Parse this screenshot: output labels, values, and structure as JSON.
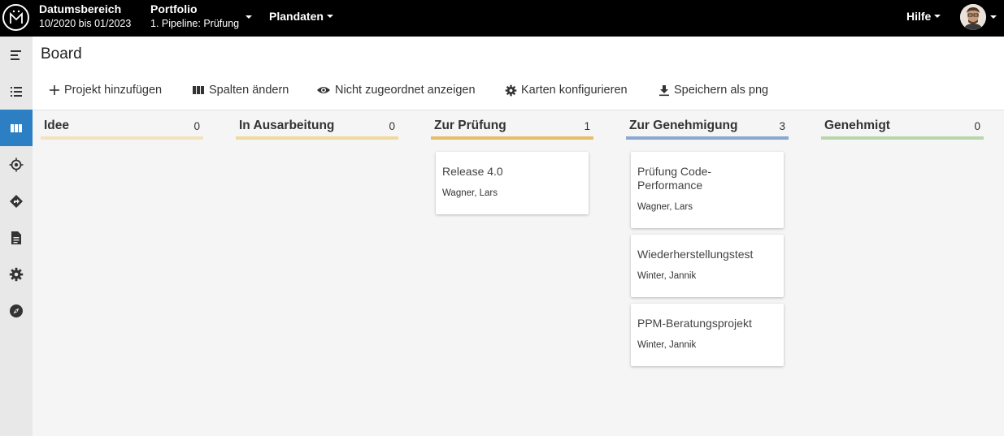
{
  "topbar": {
    "date_range": {
      "title": "Datumsbereich",
      "value": "10/2020 bis 01/2023"
    },
    "portfolio": {
      "title": "Portfolio",
      "value": "1. Pipeline: Prüfung"
    },
    "plandaten_label": "Plandaten",
    "help_label": "Hilfe"
  },
  "sidebar": {
    "items": [
      {
        "icon": "collapse-menu-icon"
      },
      {
        "icon": "list-icon"
      },
      {
        "icon": "board-icon",
        "active": true
      },
      {
        "icon": "target-icon"
      },
      {
        "icon": "directions-icon"
      },
      {
        "icon": "document-icon"
      },
      {
        "icon": "settings-icon"
      },
      {
        "icon": "compass-icon"
      }
    ]
  },
  "page": {
    "title": "Board"
  },
  "toolbar": {
    "add_project": "Projekt hinzufügen",
    "change_columns": "Spalten ändern",
    "show_unassigned": "Nicht zugeordnet anzeigen",
    "configure_cards": "Karten konfigurieren",
    "save_png": "Speichern als png"
  },
  "columns": [
    {
      "title": "Idee",
      "count": "0",
      "color": "#f3e2bd",
      "cards": []
    },
    {
      "title": "In Ausarbeitung",
      "count": "0",
      "color": "#f0d99a",
      "cards": []
    },
    {
      "title": "Zur Prüfung",
      "count": "1",
      "color": "#e6be6a",
      "cards": [
        {
          "title": "Release 4.0",
          "person": "Wagner, Lars"
        }
      ]
    },
    {
      "title": "Zur Genehmigung",
      "count": "3",
      "color": "#8aa8d0",
      "cards": [
        {
          "title": "Prüfung Code-Performance",
          "person": "Wagner, Lars"
        },
        {
          "title": "Wiederherstellungstest",
          "person": "Winter, Jannik"
        },
        {
          "title": "PPM-Beratungsprojekt",
          "person": "Winter, Jannik"
        }
      ]
    },
    {
      "title": "Genehmigt",
      "count": "0",
      "color": "#b9d6ab",
      "cards": []
    }
  ]
}
